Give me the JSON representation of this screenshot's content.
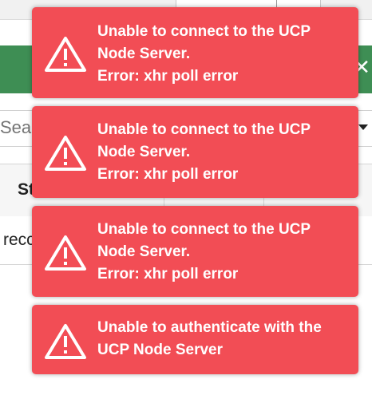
{
  "background": {
    "search_placeholder": "Sear",
    "table_header_partial": "St",
    "table_row_partial": "recc",
    "close_glyph": "✕"
  },
  "toasts": [
    {
      "lines": [
        "Unable to connect to the UCP",
        "Node Server.",
        "Error: xhr poll error"
      ],
      "icon": "warning-triangle-icon"
    },
    {
      "lines": [
        "Unable to connect to the UCP",
        "Node Server.",
        "Error: xhr poll error"
      ],
      "icon": "warning-triangle-icon"
    },
    {
      "lines": [
        "Unable to connect to the UCP",
        "Node Server.",
        "Error: xhr poll error"
      ],
      "icon": "warning-triangle-icon"
    },
    {
      "lines": [
        "Unable to authenticate with the",
        "UCP Node Server"
      ],
      "icon": "warning-triangle-icon"
    }
  ],
  "colors": {
    "toast_bg": "#f24d55",
    "banner_green": "#3e8e54"
  }
}
